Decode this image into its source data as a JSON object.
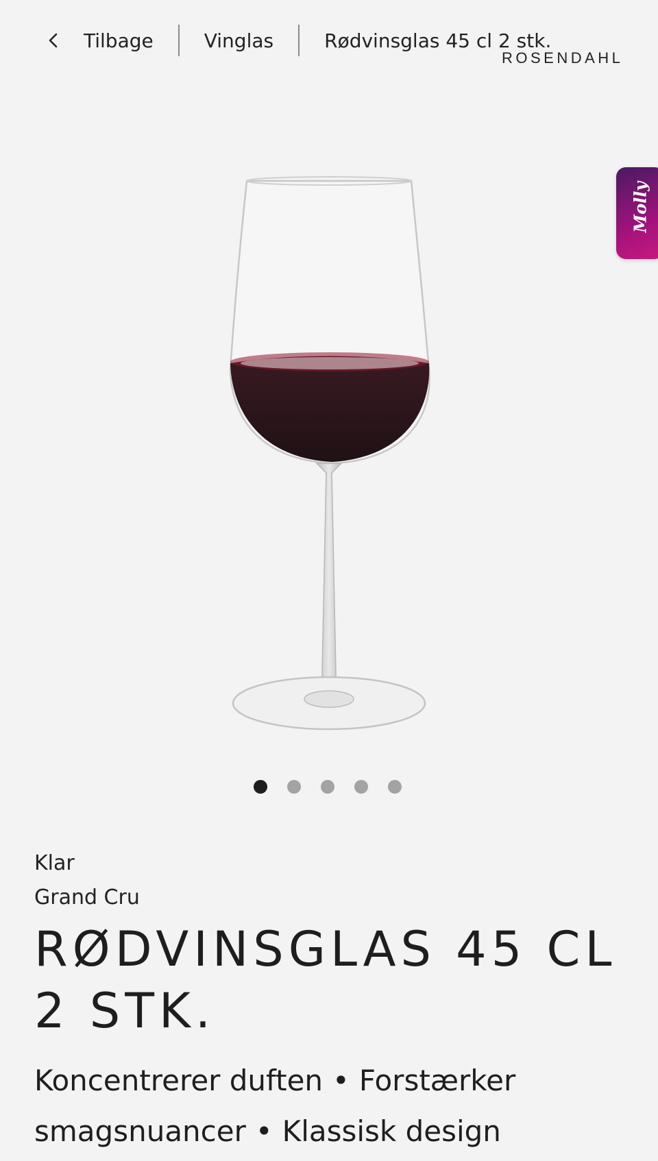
{
  "breadcrumb": {
    "back_label": "Tilbage",
    "category_label": "Vinglas",
    "current_label": "Rødvinsglas 45 cl 2 stk."
  },
  "brand": {
    "logo_text": "ROSENDAHL"
  },
  "chat_widget": {
    "label": "Molly",
    "gradient_colors": [
      "#4a1a63",
      "#c8197f"
    ]
  },
  "carousel": {
    "total_slides": 5,
    "active_index": 0
  },
  "product": {
    "variant": "Klar",
    "series": "Grand Cru",
    "title": "RØDVINSGLAS 45 CL 2 STK.",
    "features": [
      "Koncentrerer duften",
      "Forstærker smagsnuancer",
      "Klassisk design"
    ],
    "bullet_separator": "•",
    "image_subject": "red-wine-glass-icon"
  }
}
